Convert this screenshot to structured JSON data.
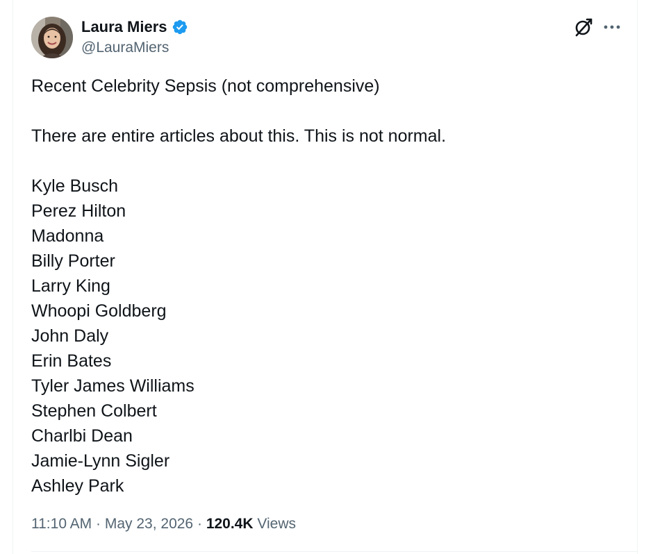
{
  "author": {
    "name": "Laura Miers",
    "handle": "@LauraMiers",
    "verified_color": "#1d9bf0"
  },
  "actions": {
    "grok_icon": "grok-icon",
    "more_icon": "more-icon"
  },
  "tweet": {
    "line1": "Recent Celebrity Sepsis (not comprehensive)",
    "line2": "There are entire articles about this. This is not normal.",
    "names": [
      "Kyle Busch",
      "Perez Hilton",
      "Madonna",
      "Billy Porter",
      "Larry King",
      "Whoopi Goldberg",
      "John Daly",
      "Erin Bates",
      "Tyler James Williams",
      "Stephen Colbert",
      "Charlbi Dean",
      "Jamie-Lynn Sigler",
      "Ashley Park"
    ]
  },
  "meta": {
    "time": "11:10 AM",
    "separator": "·",
    "date": "May 23, 2026",
    "views_count": "120.4K",
    "views_label": "Views"
  }
}
